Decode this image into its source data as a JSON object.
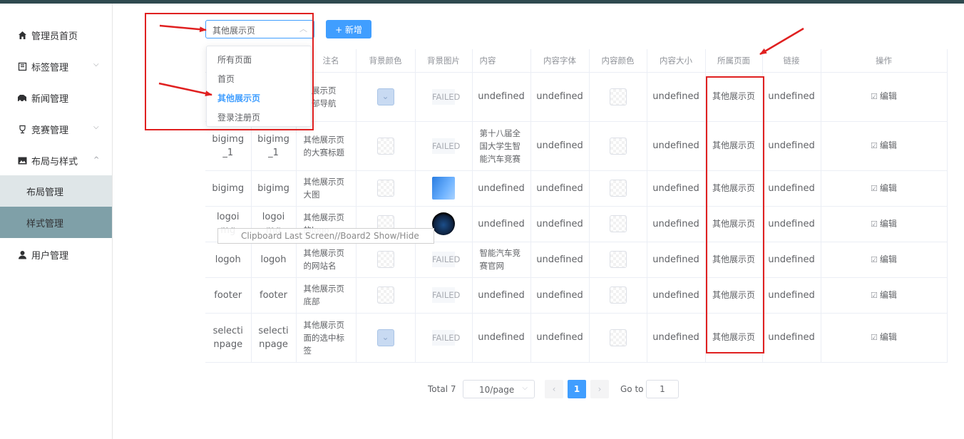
{
  "sidebar": {
    "items": [
      {
        "label": "管理员首页",
        "icon": "home-icon"
      },
      {
        "label": "标签管理",
        "icon": "tag-icon",
        "chevron": "⌵"
      },
      {
        "label": "新闻管理",
        "icon": "news-icon"
      },
      {
        "label": "竞赛管理",
        "icon": "trophy-icon",
        "chevron": "⌵"
      },
      {
        "label": "布局与样式",
        "icon": "image-icon",
        "chevron": "^"
      },
      {
        "label": "用户管理",
        "icon": "user-icon"
      }
    ],
    "sub_items": [
      {
        "label": "布局管理"
      },
      {
        "label": "样式管理"
      }
    ]
  },
  "toolbar": {
    "select_value": "其他展示页",
    "add_label": "+ 新增"
  },
  "dropdown": {
    "options": [
      "所有页面",
      "首页",
      "其他展示页",
      "登录注册页"
    ],
    "selected": "其他展示页"
  },
  "table": {
    "headers": [
      "",
      "",
      "注名",
      "背景颜色",
      "背景图片",
      "内容",
      "内容字体",
      "内容颜色",
      "内容大小",
      "所属页面",
      "链接",
      "操作"
    ],
    "rows": [
      {
        "c1": "",
        "c2": "",
        "name": "其他展示页顶部导航",
        "name_display": "他展示页\n顶部导航",
        "bgcolor": "blue",
        "bgimg": "FAILED",
        "content": "undefined",
        "font": "undefined",
        "color": "checker",
        "size": "undefined",
        "page": "其他展示页",
        "link": "undefined",
        "op": "编辑"
      },
      {
        "c1": "bigimg_1",
        "c2": "bigimg_1",
        "name": "其他展示页的大赛标题",
        "bgcolor": "checker",
        "bgimg": "FAILED",
        "content": "第十八届全国大学生智能汽车竞赛",
        "font": "undefined",
        "color": "checker",
        "size": "undefined",
        "page": "其他展示页",
        "link": "undefined",
        "op": "编辑"
      },
      {
        "c1": "bigimg",
        "c2": "bigimg",
        "name": "其他展示页大图",
        "bgcolor": "checker",
        "bgimg": "image-blue",
        "content": "undefined",
        "font": "undefined",
        "color": "checker",
        "size": "undefined",
        "page": "其他展示页",
        "link": "undefined",
        "op": "编辑"
      },
      {
        "c1": "logoimg",
        "c2": "logoimg",
        "name": "其他展示页的logo",
        "bgcolor": "checker",
        "bgimg": "image-logo",
        "content": "undefined",
        "font": "undefined",
        "color": "checker",
        "size": "undefined",
        "page": "其他展示页",
        "link": "undefined",
        "op": "编辑"
      },
      {
        "c1": "logoh",
        "c2": "logoh",
        "name": "其他展示页的网站名",
        "bgcolor": "checker",
        "bgimg": "FAILED",
        "content": "智能汽车竞赛官网",
        "font": "undefined",
        "color": "checker",
        "size": "undefined",
        "page": "其他展示页",
        "link": "undefined",
        "op": "编辑"
      },
      {
        "c1": "footer",
        "c2": "footer",
        "name": "其他展示页底部",
        "bgcolor": "checker",
        "bgimg": "FAILED",
        "content": "undefined",
        "font": "undefined",
        "color": "checker",
        "size": "undefined",
        "page": "其他展示页",
        "link": "undefined",
        "op": "编辑"
      },
      {
        "c1": "selectinpage",
        "c2": "selectinpage",
        "name": "其他展示页面的选中标签",
        "bgcolor": "blue",
        "bgimg": "FAILED",
        "content": "undefined",
        "font": "undefined",
        "color": "checker",
        "size": "undefined",
        "page": "其他展示页",
        "link": "undefined",
        "op": "编辑"
      }
    ],
    "failed_text": "FAILED"
  },
  "tooltip": {
    "text": "Clipboard Last Screen//Board2 Show/Hide"
  },
  "pagination": {
    "total_label": "Total 7",
    "page_size": "10/page",
    "current_page": "1",
    "goto_label": "Go to",
    "goto_value": "1"
  },
  "colors": {
    "accent": "#409eff",
    "annotation": "#e02020",
    "sidebar_active_bg": "#7fa0a8",
    "sidebar_sub_bg": "#dfe6e8"
  }
}
